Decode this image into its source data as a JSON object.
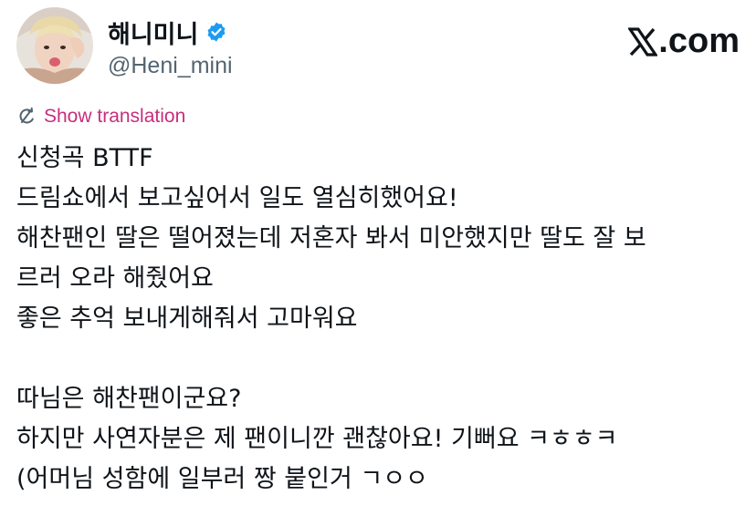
{
  "author": {
    "display_name": "해니미니",
    "handle": "@Heni_mini",
    "verified": true
  },
  "site": {
    "logo_text": ".com"
  },
  "translation": {
    "label": "Show translation",
    "color": "#c72e7c"
  },
  "tweet": {
    "lines": [
      "신청곡 BTTF",
      "드림쇼에서 보고싶어서 일도 열심히했어요!",
      "해찬팬인 딸은 떨어졌는데 저혼자 봐서 미안했지만 딸도 잘 보",
      "르러 오라 해줬어요",
      "좋은 추억 보내게해줘서 고마워요",
      "",
      "따님은 해찬팬이군요?",
      "하지만 사연자분은 제 팬이니깐 괜찮아요! 기뻐요 ㅋㅎㅎㅋ",
      "(어머님 성함에 일부러 짱 붙인거 ㄱㅇㅇ"
    ]
  },
  "colors": {
    "verified_badge": "#1d9bf0",
    "text_primary": "#0f1419",
    "text_secondary": "#536471"
  }
}
